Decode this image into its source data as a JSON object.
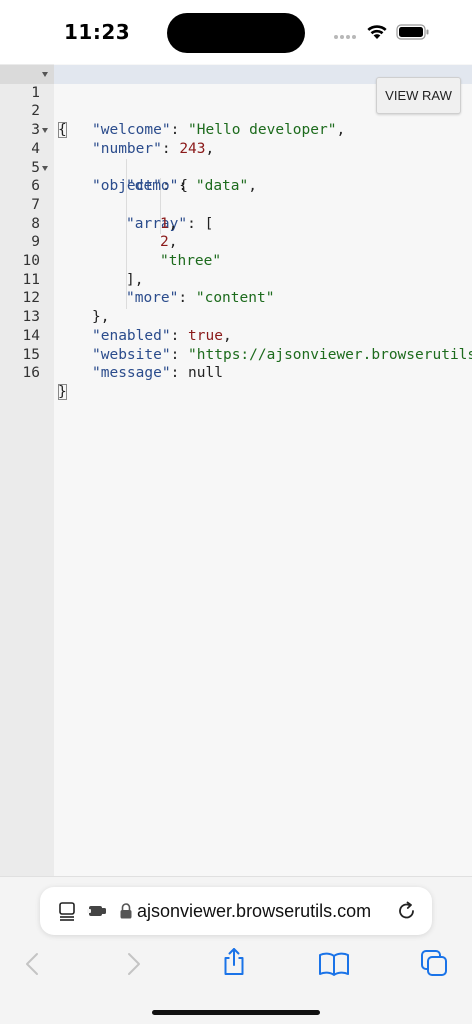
{
  "status_bar": {
    "time": "11:23"
  },
  "editor": {
    "view_raw_label": "VIEW RAW",
    "lines": [
      {
        "num": "1",
        "fold": true
      },
      {
        "num": "2",
        "fold": false
      },
      {
        "num": "3",
        "fold": false
      },
      {
        "num": "4",
        "fold": true
      },
      {
        "num": "5",
        "fold": false
      },
      {
        "num": "6",
        "fold": true
      },
      {
        "num": "7",
        "fold": false
      },
      {
        "num": "8",
        "fold": false
      },
      {
        "num": "9",
        "fold": false
      },
      {
        "num": "10",
        "fold": false
      },
      {
        "num": "11",
        "fold": false
      },
      {
        "num": "12",
        "fold": false
      },
      {
        "num": "13",
        "fold": false
      },
      {
        "num": "14",
        "fold": false
      },
      {
        "num": "15",
        "fold": false
      },
      {
        "num": "16",
        "fold": false
      }
    ],
    "tokens": {
      "open_brace": "{",
      "close_brace": "}",
      "welcome_key": "\"welcome\"",
      "welcome_value": "\"Hello developer\"",
      "number_key": "\"number\"",
      "number_value": "243",
      "object_key": "\"object\"",
      "demo_key": "\"demo\"",
      "demo_value": "\"data\"",
      "array_key": "\"array\"",
      "array_item_1": "1",
      "array_item_2": "2",
      "array_item_3": "\"three\"",
      "more_key": "\"more\"",
      "more_value": "\"content\"",
      "enabled_key": "\"enabled\"",
      "enabled_value": "true",
      "website_key": "\"website\"",
      "website_value": "\"https://ajsonviewer.browserutils",
      "message_key": "\"message\"",
      "message_value": "null"
    }
  },
  "browser": {
    "url": "ajsonviewer.browserutils.com",
    "icons": [
      "reader-icon",
      "extension-icon",
      "lock-icon",
      "reload-icon",
      "back-icon",
      "forward-icon",
      "share-icon",
      "bookmarks-icon",
      "tabs-icon"
    ]
  },
  "colors": {
    "key": "#2b4c8c",
    "string": "#1d6b1d",
    "number": "#8b1a1a",
    "accent": "#1a73e8"
  }
}
